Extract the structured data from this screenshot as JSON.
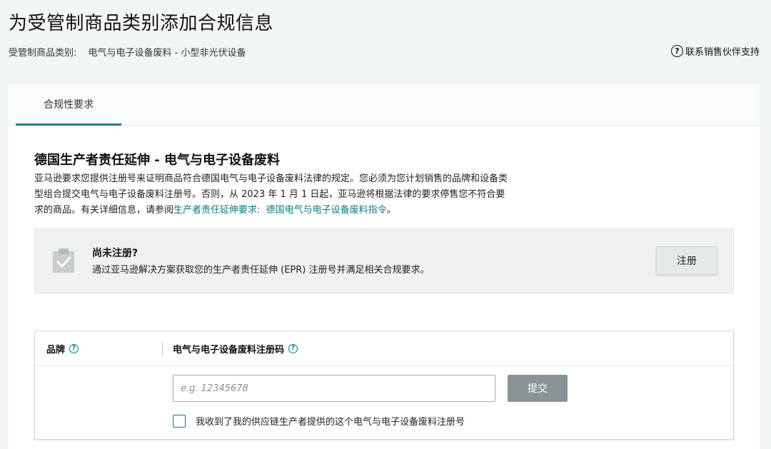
{
  "page": {
    "title": "为受管制商品类别添加合规信息",
    "category_label": "受管制商品类别:",
    "category_value": "电气与电子设备废料 - 小型非光伏设备",
    "support_link": "联系销售伙伴支持"
  },
  "tabs": [
    {
      "label": "合规性要求",
      "active": true
    }
  ],
  "section": {
    "title": "德国生产者责任延伸 - 电气与电子设备废料",
    "description_line1": "亚马逊要求您提供注册号来证明商品符合德国电气与电子设备废料法律的规定。您必须为您计划销售的品牌和设备类",
    "description_line2": "型组合提交电气与电子设备废料注册号。否则，从 2023 年 1 月 1 日起，亚马逊将根据法律的要求停售您不符合要",
    "description_line3_prefix": "求的商品。有关详细信息，请参阅",
    "link_epr": "生产者责任延伸要求:",
    "link_weee": "德国电气与电子设备废料指令",
    "description_suffix": "。"
  },
  "notice": {
    "icon": "clipboard-check-icon",
    "title": "尚未注册?",
    "text": "通过亚马逊解决方案获取您的生产者责任延伸 (EPR) 注册号并满足相关合规要求。",
    "button_label": "注册"
  },
  "table": {
    "headers": {
      "brand": "品牌",
      "code": "电气与电子设备废料注册码"
    },
    "input_placeholder": "e.g. 12345678",
    "input_value": "",
    "submit_label": "提交",
    "confirm_label": "我收到了我的供应链生产者提供的这个电气与电子设备废料注册号",
    "confirm_checked": false
  },
  "colors": {
    "accent": "#0a7b83",
    "tab_underline": "#2a7a86",
    "background": "#f3f6f6",
    "submit_disabled": "#8b9494"
  }
}
